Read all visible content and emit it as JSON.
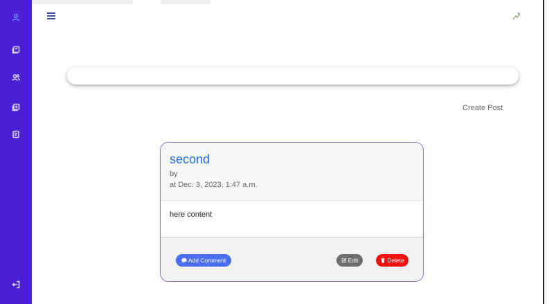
{
  "sidebar": {
    "items": [
      {
        "name": "user",
        "icon": "user-icon"
      },
      {
        "name": "posts",
        "icon": "posts-icon"
      },
      {
        "name": "users",
        "icon": "users-icon"
      },
      {
        "name": "add-post",
        "icon": "add-post-icon"
      },
      {
        "name": "documents",
        "icon": "document-icon"
      }
    ],
    "logout_icon": "logout-icon",
    "accent_color": "#4a1fd6"
  },
  "header": {
    "menu_icon": "hamburger-icon",
    "avatar_icon": "broken-image-icon"
  },
  "search": {
    "value": "",
    "placeholder": ""
  },
  "actions": {
    "create_post_label": "Create Post"
  },
  "post": {
    "title": "second",
    "by_label": "by",
    "date": "at Dec. 3, 2023, 1:47 a.m.",
    "content": "here content",
    "buttons": {
      "add_comment_label": "Add Comment",
      "edit_label": "Edit",
      "delete_label": "Delete"
    }
  }
}
